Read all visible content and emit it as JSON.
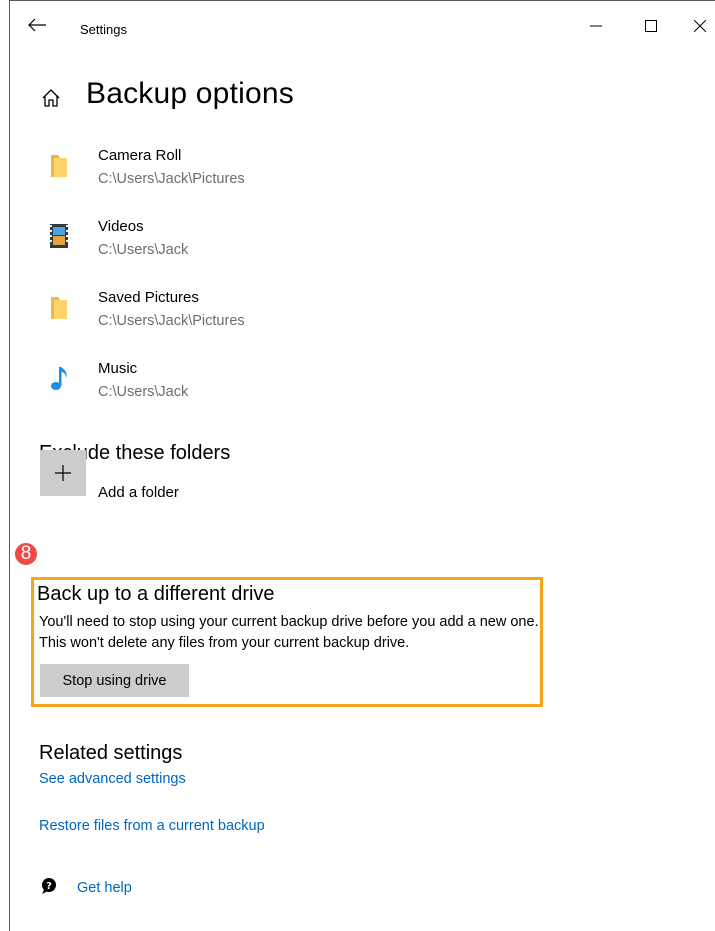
{
  "titlebar": {
    "title": "Settings",
    "back_icon": "arrow-left-icon",
    "minimize_icon": "minimize-icon",
    "maximize_icon": "maximize-icon",
    "close_icon": "close-icon"
  },
  "header": {
    "home_icon": "home-icon",
    "title": "Backup options"
  },
  "folders": [
    {
      "name": "Camera Roll",
      "path": "C:\\Users\\Jack\\Pictures",
      "icon": "folder-icon"
    },
    {
      "name": "Videos",
      "path": "C:\\Users\\Jack",
      "icon": "videos-icon"
    },
    {
      "name": "Saved Pictures",
      "path": "C:\\Users\\Jack\\Pictures",
      "icon": "folder-icon"
    },
    {
      "name": "Music",
      "path": "C:\\Users\\Jack",
      "icon": "music-note-icon"
    }
  ],
  "exclude": {
    "title": "Exclude these folders",
    "add_label": "Add a folder",
    "add_icon": "plus-icon"
  },
  "different_drive": {
    "badge": "8",
    "title": "Back up to a different drive",
    "description": "You'll need to stop using your current backup drive before you add a new one. This won't delete any files from your current backup drive.",
    "button_label": "Stop using drive"
  },
  "related": {
    "title": "Related settings",
    "links": [
      "See advanced settings",
      "Restore files from a current backup"
    ],
    "help_label": "Get help",
    "help_icon": "help-chat-icon"
  },
  "colors": {
    "link": "#0067c0",
    "highlight": "#f5a71c",
    "badge": "#f04b46",
    "button_bg": "#cccccc"
  }
}
